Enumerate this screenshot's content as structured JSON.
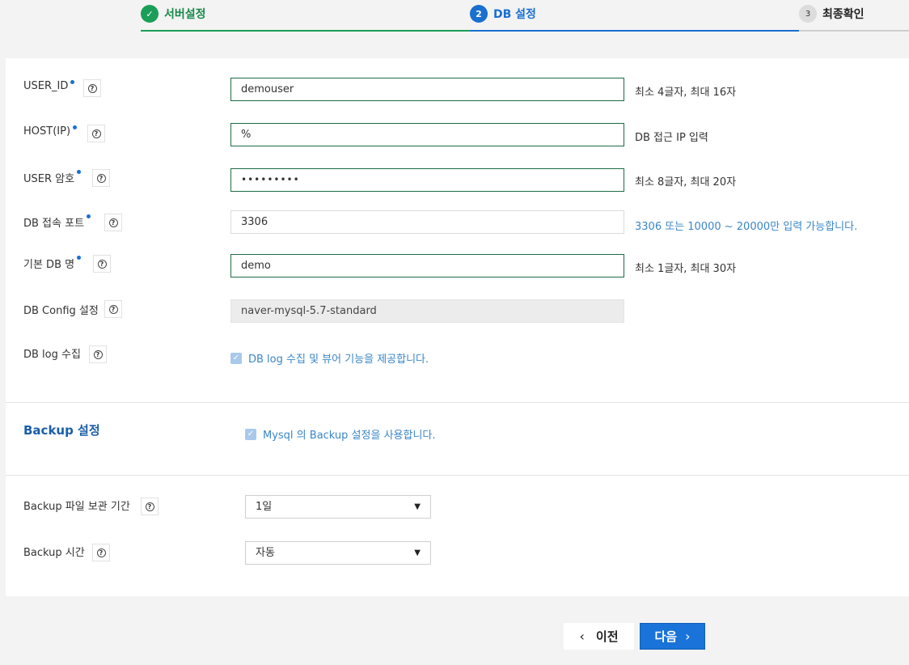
{
  "stepper": {
    "step1": {
      "icon": "✓",
      "label": "서버설정"
    },
    "step2": {
      "number": "2",
      "label": "DB 설정"
    },
    "step3": {
      "number": "3",
      "label": "최종확인"
    }
  },
  "form": {
    "user_id": {
      "label": "USER_ID",
      "value": "demouser",
      "hint": "최소 4글자, 최대 16자"
    },
    "host": {
      "label": "HOST(IP)",
      "value": "%",
      "hint": "DB 접근 IP 입력"
    },
    "password": {
      "label": "USER 암호",
      "value": "•••••••••",
      "hint": "최소 8글자, 최대 20자"
    },
    "port": {
      "label": "DB 접속 포트",
      "value": "3306",
      "hint": "3306 또는 10000 ~ 20000만 입력 가능합니다."
    },
    "db_name": {
      "label": "기본 DB 명",
      "value": "demo",
      "hint": "최소 1글자, 최대 30자"
    },
    "db_config": {
      "label": "DB Config 설정",
      "value": "naver-mysql-5.7-standard"
    },
    "db_log": {
      "label": "DB log 수집",
      "checkbox_label": "DB log 수집 및 뷰어 기능을 제공합니다.",
      "checked": true
    }
  },
  "backup": {
    "title": "Backup 설정",
    "checkbox_label": "Mysql 의 Backup 설정을 사용합니다.",
    "checked": true,
    "retention": {
      "label": "Backup 파일 보관 기간",
      "value": "1일"
    },
    "time": {
      "label": "Backup 시간",
      "value": "자동"
    }
  },
  "buttons": {
    "prev": "이전",
    "next": "다음"
  },
  "icons": {
    "help": "?",
    "check": "✓",
    "dropdown": "▼",
    "chev_left": "‹",
    "chev_right": "›"
  },
  "colors": {
    "primary": "#1a73d9",
    "success": "#1b9e58",
    "hint_blue": "#3a86c8"
  }
}
